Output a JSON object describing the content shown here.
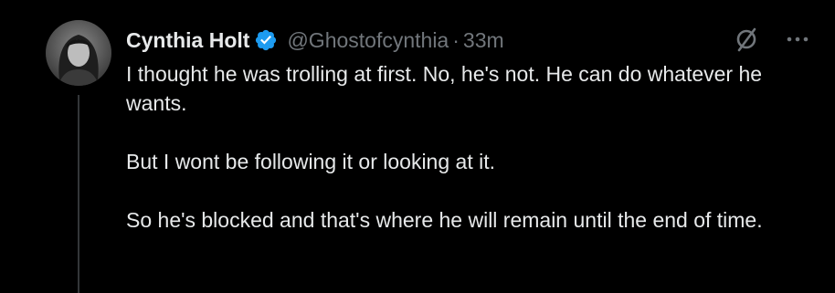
{
  "author": {
    "display_name": "Cynthia Holt",
    "handle": "@Ghostofcynthia",
    "separator": "·",
    "timestamp": "33m",
    "verified": true
  },
  "tweet": {
    "paragraphs": [
      "I thought he was trolling at first. No, he's not. He can do whatever he wants.",
      "But I wont be following it or looking at it.",
      "So he's blocked and that's where he will remain until the end of time."
    ]
  },
  "icons": {
    "verified": "verified-badge-icon",
    "grok": "grok-icon",
    "more": "more-options-icon"
  },
  "colors": {
    "background": "#000000",
    "text": "#e7e9ea",
    "muted": "#71767b",
    "verified_blue": "#1d9bf0",
    "thread_line": "#333639"
  }
}
